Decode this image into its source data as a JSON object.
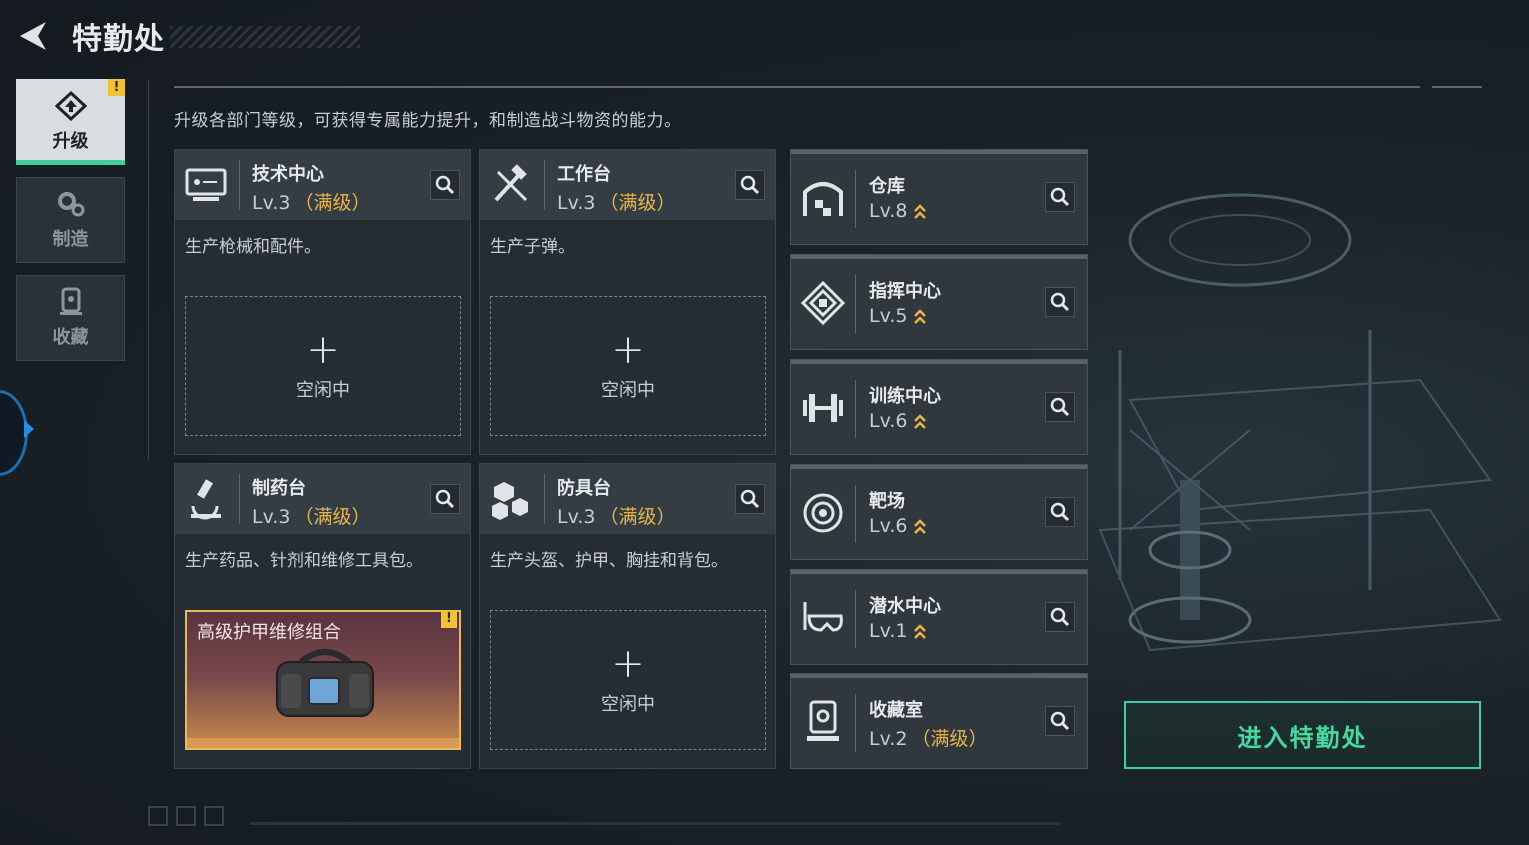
{
  "header": {
    "title": "特勤处"
  },
  "sidebar": {
    "tabs": [
      {
        "label": "升级",
        "icon": "upgrade-icon",
        "active": true,
        "alert": "!"
      },
      {
        "label": "制造",
        "icon": "gear-icon",
        "active": false
      },
      {
        "label": "收藏",
        "icon": "collection-icon",
        "active": false
      }
    ]
  },
  "description": "升级各部门等级，可获得专属能力提升，和制造战斗物资的能力。",
  "workshops": [
    {
      "name": "技术中心",
      "level": "Lv.3",
      "maxed": "（满级）",
      "desc": "生产枪械和配件。",
      "slot": {
        "plus": "+",
        "status": "空闲中"
      },
      "icon": "monitor-icon"
    },
    {
      "name": "工作台",
      "level": "Lv.3",
      "maxed": "（满级）",
      "desc": "生产子弹。",
      "slot": {
        "plus": "+",
        "status": "空闲中"
      },
      "icon": "tools-icon"
    },
    {
      "name": "制药台",
      "level": "Lv.3",
      "maxed": "（满级）",
      "desc": "生产药品、针剂和维修工具包。",
      "product": {
        "name": "高级护甲维修组合",
        "alert": "!"
      },
      "icon": "microscope-icon"
    },
    {
      "name": "防具台",
      "level": "Lv.3",
      "maxed": "（满级）",
      "desc": "生产头盔、护甲、胸挂和背包。",
      "slot": {
        "plus": "+",
        "status": "空闲中"
      },
      "icon": "armor-parts-icon"
    }
  ],
  "buildings": [
    {
      "name": "仓库",
      "level": "Lv.8",
      "upgradable": true,
      "icon": "warehouse-icon"
    },
    {
      "name": "指挥中心",
      "level": "Lv.5",
      "upgradable": true,
      "icon": "command-icon"
    },
    {
      "name": "训练中心",
      "level": "Lv.6",
      "upgradable": true,
      "icon": "dumbbell-icon"
    },
    {
      "name": "靶场",
      "level": "Lv.6",
      "upgradable": true,
      "icon": "target-icon"
    },
    {
      "name": "潜水中心",
      "level": "Lv.1",
      "upgradable": true,
      "icon": "diving-mask-icon"
    },
    {
      "name": "收藏室",
      "level": "Lv.2",
      "maxed": "（满级）",
      "upgradable": false,
      "icon": "collection-room-icon"
    }
  ],
  "enter_button": "进入特勤处",
  "colors": {
    "accent": "#3ecf9b",
    "maxed": "#e8b447",
    "alert": "#f1c232"
  }
}
